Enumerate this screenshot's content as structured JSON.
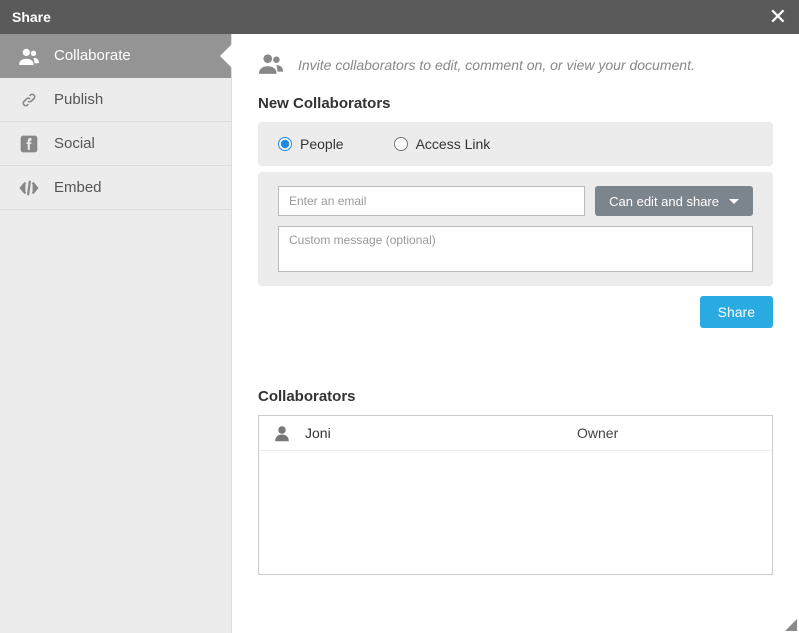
{
  "title": "Share",
  "sidebar": {
    "items": [
      {
        "label": "Collaborate",
        "active": true
      },
      {
        "label": "Publish",
        "active": false
      },
      {
        "label": "Social",
        "active": false
      },
      {
        "label": "Embed",
        "active": false
      }
    ]
  },
  "intro_text": "Invite collaborators to edit, comment on, or view your document.",
  "new_collab_heading": "New Collaborators",
  "radios": {
    "people": "People",
    "access_link": "Access Link",
    "selected": "people"
  },
  "email_placeholder": "Enter an email",
  "permission_label": "Can edit and share",
  "message_placeholder": "Custom message (optional)",
  "share_button": "Share",
  "collab_heading": "Collaborators",
  "collaborators": [
    {
      "name": "Joni",
      "role": "Owner"
    }
  ]
}
